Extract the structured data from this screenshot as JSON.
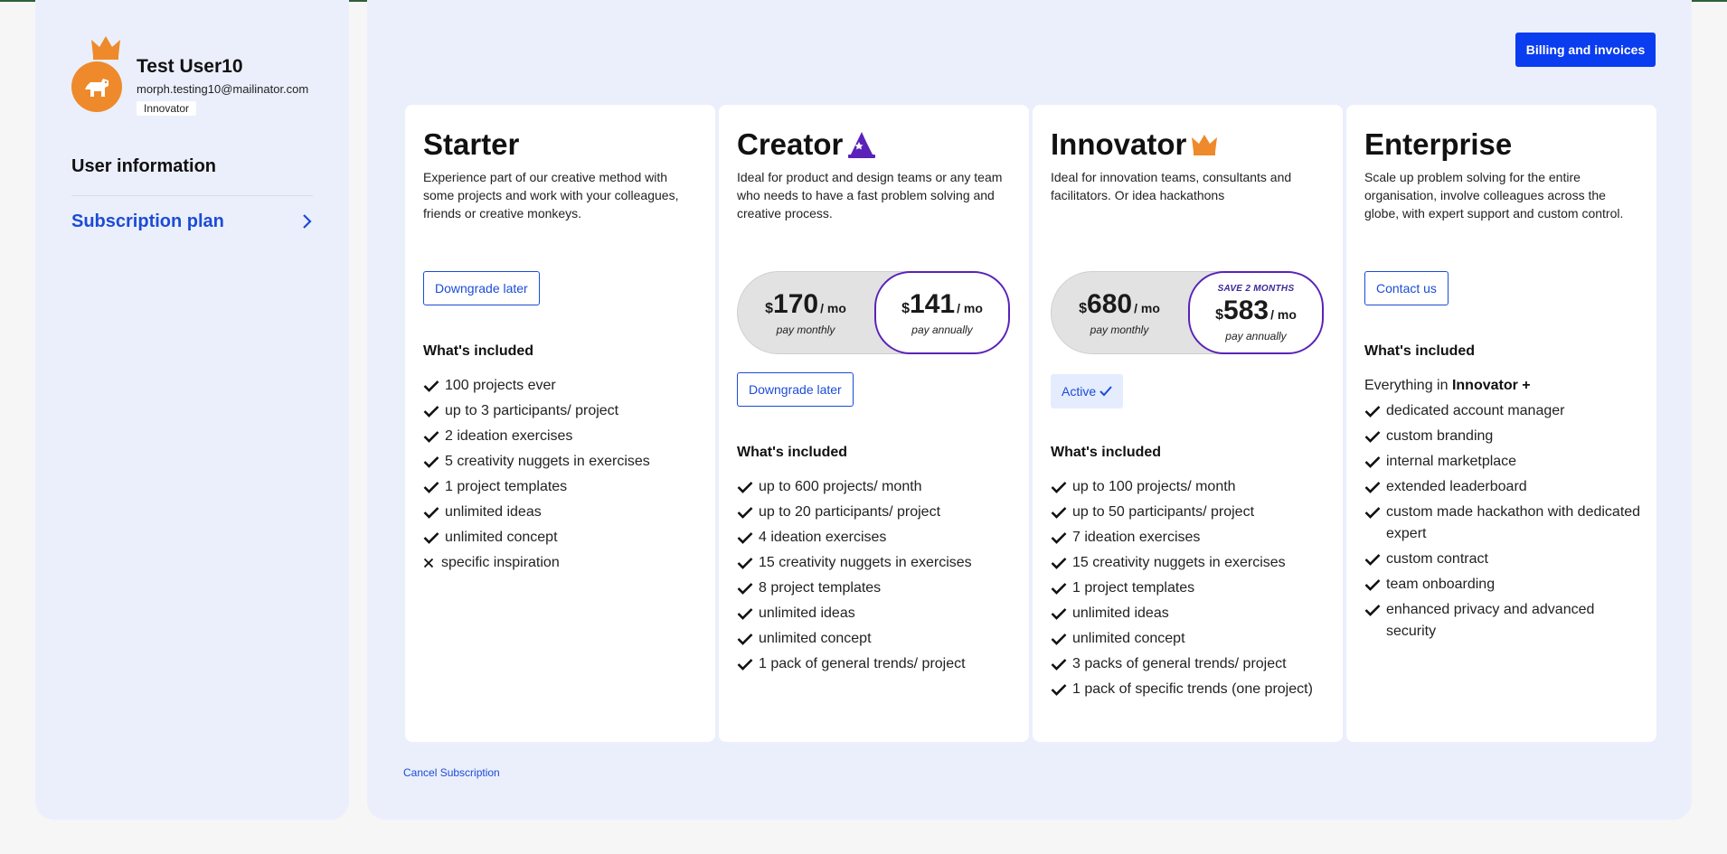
{
  "user": {
    "name": "Test User10",
    "email": "morph.testing10@mailinator.com",
    "tier": "Innovator"
  },
  "sidebar": {
    "user_information": "User information",
    "subscription_plan": "Subscription plan"
  },
  "header": {
    "billing_label": "Billing and invoices"
  },
  "included_label": "What's included",
  "plans": [
    {
      "title": "Starter",
      "icon": "none",
      "description": "Experience part of our creative method with some projects and work with your colleagues, friends or creative monkeys.",
      "button_label": "Downgrade later",
      "features": [
        {
          "text": "100 projects ever",
          "included": true
        },
        {
          "text": "up to 3 participants/ project",
          "included": true
        },
        {
          "text": "2 ideation exercises",
          "included": true
        },
        {
          "text": "5 creativity nuggets in exercises",
          "included": true
        },
        {
          "text": "1 project templates",
          "included": true
        },
        {
          "text": "unlimited ideas",
          "included": true
        },
        {
          "text": "unlimited concept",
          "included": true
        },
        {
          "text": "specific inspiration",
          "included": false
        }
      ]
    },
    {
      "title": "Creator",
      "icon": "wizard-hat-icon",
      "description": "Ideal for product and design teams or any team who needs to have a fast problem solving and creative process.",
      "monthly": {
        "currency": "$",
        "amount": "170",
        "per": "/ mo",
        "label": "pay monthly"
      },
      "annual": {
        "currency": "$",
        "amount": "141",
        "per": "/ mo",
        "label": "pay annually"
      },
      "button_label": "Downgrade later",
      "features": [
        {
          "text": "up to 600 projects/ month",
          "included": true
        },
        {
          "text": "up to 20 participants/ project",
          "included": true
        },
        {
          "text": "4 ideation exercises",
          "included": true
        },
        {
          "text": "15 creativity nuggets in exercises",
          "included": true
        },
        {
          "text": "8 project templates",
          "included": true
        },
        {
          "text": "unlimited ideas",
          "included": true
        },
        {
          "text": "unlimited concept",
          "included": true
        },
        {
          "text": "1 pack of general trends/ project",
          "included": true
        }
      ]
    },
    {
      "title": "Innovator",
      "icon": "crown-icon",
      "description": "Ideal for innovation teams, consultants and facilitators. Or idea hackathons",
      "monthly": {
        "currency": "$",
        "amount": "680",
        "per": "/ mo",
        "label": "pay monthly"
      },
      "annual": {
        "currency": "$",
        "amount": "583",
        "per": "/ mo",
        "label": "pay annually",
        "save": "SAVE 2 MONTHS"
      },
      "active_label": "Active",
      "features": [
        {
          "text": "up to 100 projects/ month",
          "included": true
        },
        {
          "text": "up to 50 participants/ project",
          "included": true
        },
        {
          "text": "7 ideation exercises",
          "included": true
        },
        {
          "text": "15 creativity nuggets in exercises",
          "included": true
        },
        {
          "text": "1 project templates",
          "included": true
        },
        {
          "text": "unlimited ideas",
          "included": true
        },
        {
          "text": "unlimited concept",
          "included": true
        },
        {
          "text": "3 packs of general trends/ project",
          "included": true
        },
        {
          "text": "1 pack of specific trends (one project)",
          "included": true
        }
      ]
    },
    {
      "title": "Enterprise",
      "icon": "none",
      "description": "Scale up problem solving for the entire organisation, involve colleagues across the globe, with expert support and custom control.",
      "button_label": "Contact us",
      "intro_prefix": "Everything in",
      "intro_plan": "Innovator +",
      "features": [
        {
          "text": "dedicated account manager",
          "included": true
        },
        {
          "text": "custom branding",
          "included": true
        },
        {
          "text": "internal marketplace",
          "included": true
        },
        {
          "text": "extended leaderboard",
          "included": true
        },
        {
          "text": "custom made hackathon with dedicated expert",
          "included": true
        },
        {
          "text": "custom contract",
          "included": true
        },
        {
          "text": "team onboarding",
          "included": true
        },
        {
          "text": "enhanced privacy and advanced security",
          "included": true
        }
      ]
    }
  ],
  "footer": {
    "cancel_label": "Cancel Subscription"
  },
  "colors": {
    "accent": "#1b4cd6",
    "primary_button": "#0a3cf0",
    "avatar_orange": "#ee8a2b",
    "annual_border": "#5a22b8",
    "panel_bg": "#ebeffc"
  }
}
